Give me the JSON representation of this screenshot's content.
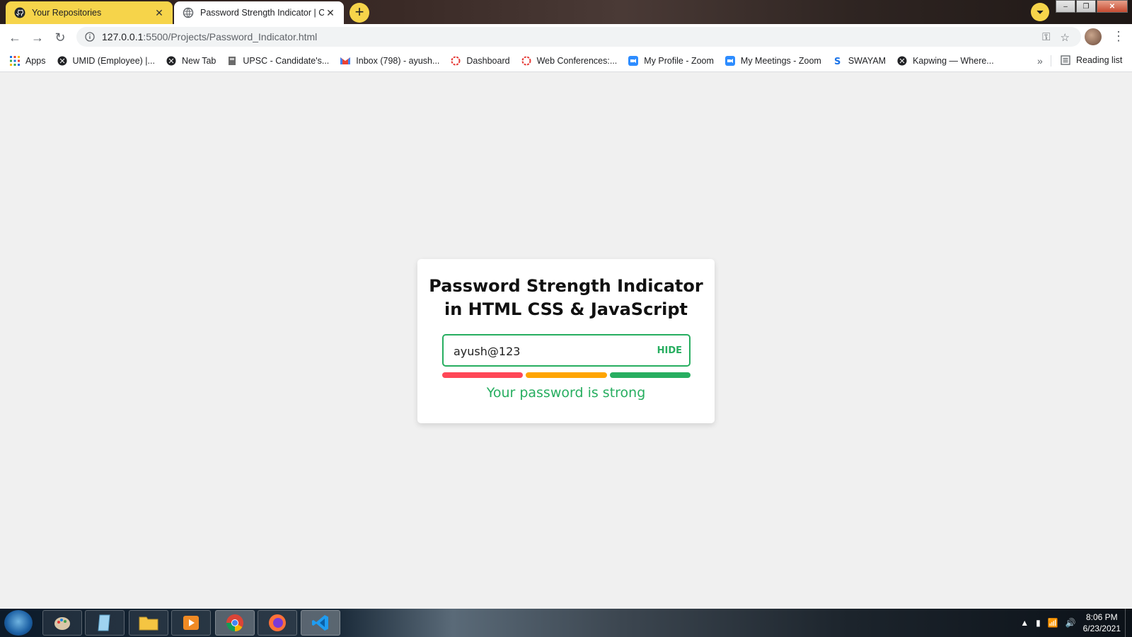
{
  "browser": {
    "tabs": [
      {
        "title": "Your Repositories",
        "icon": "github-icon",
        "active": false
      },
      {
        "title": "Password Strength Indicator | Co",
        "icon": "globe-icon",
        "active": true
      }
    ],
    "newtab_label": "+",
    "address": {
      "host": "127.0.0.1",
      "path": ":5500/Projects/Password_Indicator.html"
    },
    "window_controls": {
      "minimize": "–",
      "maximize": "❐",
      "close": "✕"
    }
  },
  "bookmarks": {
    "items": [
      {
        "label": "Apps",
        "icon": "apps-grid-icon"
      },
      {
        "label": "UMID (Employee) |...",
        "icon": "globe-icon"
      },
      {
        "label": "New Tab",
        "icon": "globe-icon"
      },
      {
        "label": "UPSC - Candidate's...",
        "icon": "emblem-icon"
      },
      {
        "label": "Inbox (798) - ayush...",
        "icon": "gmail-icon"
      },
      {
        "label": "Dashboard",
        "icon": "ring-icon"
      },
      {
        "label": "Web Conferences:...",
        "icon": "ring-icon"
      },
      {
        "label": "My Profile - Zoom",
        "icon": "zoom-icon"
      },
      {
        "label": "My Meetings - Zoom",
        "icon": "zoom-icon"
      },
      {
        "label": "SWAYAM",
        "icon": "swayam-icon"
      },
      {
        "label": "Kapwing — Where...",
        "icon": "globe-icon"
      }
    ],
    "more": "»",
    "reading_list": "Reading list"
  },
  "card": {
    "title_line1": "Password Strength Indicator",
    "title_line2": "in HTML CSS & JavaScript",
    "password_value": "ayush@123",
    "toggle_label": "HIDE",
    "strength_segments": [
      "weak",
      "medium",
      "strong"
    ],
    "segment_colors": [
      "#ff4757",
      "#ffa502",
      "#27ae60"
    ],
    "status": "Your password is strong",
    "accent_color": "#27ae60"
  },
  "taskbar": {
    "apps": [
      "paint-icon",
      "notes-icon",
      "folder-icon",
      "media-player-icon",
      "chrome-icon",
      "firefox-icon",
      "vscode-icon"
    ],
    "time": "8:06 PM",
    "date": "6/23/2021"
  }
}
